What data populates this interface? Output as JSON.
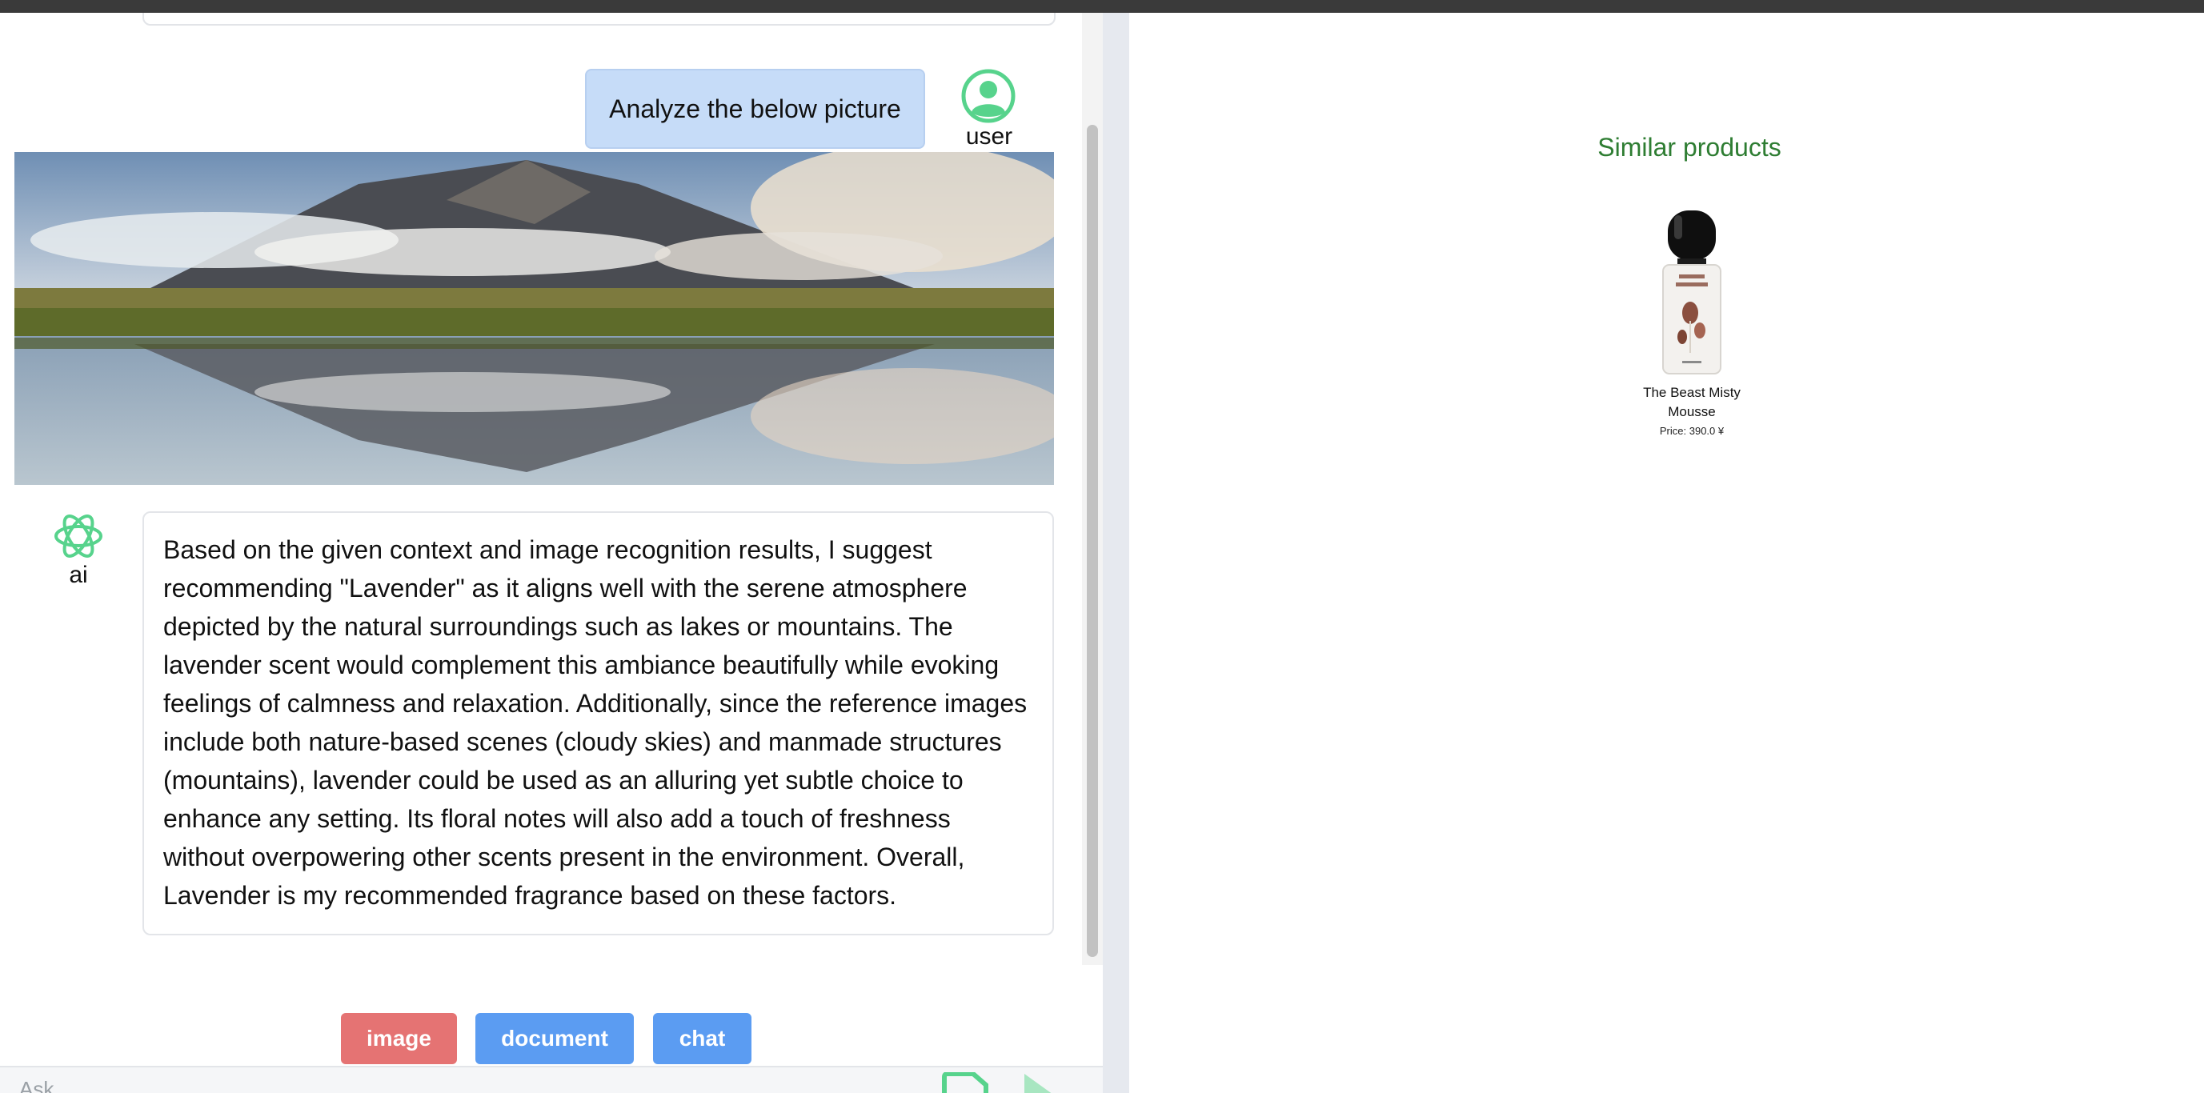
{
  "chat": {
    "messages": [
      {
        "role": "user",
        "text": "Analyze the below picture"
      },
      {
        "role": "ai",
        "text": "Based on the given context and image recognition results, I suggest recommending \"Lavender\" as it aligns well with the serene atmosphere depicted by the natural surroundings such as lakes or mountains. The lavender scent would complement this ambiance beautifully while evoking feelings of calmness and relaxation. Additionally, since the reference images include both nature-based scenes (cloudy skies) and manmade structures (mountains), lavender could be used as an alluring yet subtle choice to enhance any setting. Its floral notes will also add a touch of freshness without overpowering other scents present in the environment. Overall, Lavender is my recommended fragrance based on these factors."
      }
    ],
    "user_label": "user",
    "ai_label": "ai",
    "user_icon": "user-circle-icon",
    "ai_icon": "openai-logo-icon",
    "attached_image": "mountain-lake-reflection-photo"
  },
  "modes": {
    "image": "image",
    "document": "document",
    "chat": "chat",
    "active_color": "#e57373",
    "inactive_color": "#5b9cf2"
  },
  "input": {
    "placeholder": "Ask..."
  },
  "similar": {
    "title": "Similar products",
    "products": [
      {
        "name": "The Beast Misty Mousse",
        "price": "Price: 390.0 ¥"
      }
    ]
  },
  "colors": {
    "accent_green": "#2e7d32",
    "icon_green": "#57d38c",
    "user_bubble": "#c6dcf8"
  }
}
